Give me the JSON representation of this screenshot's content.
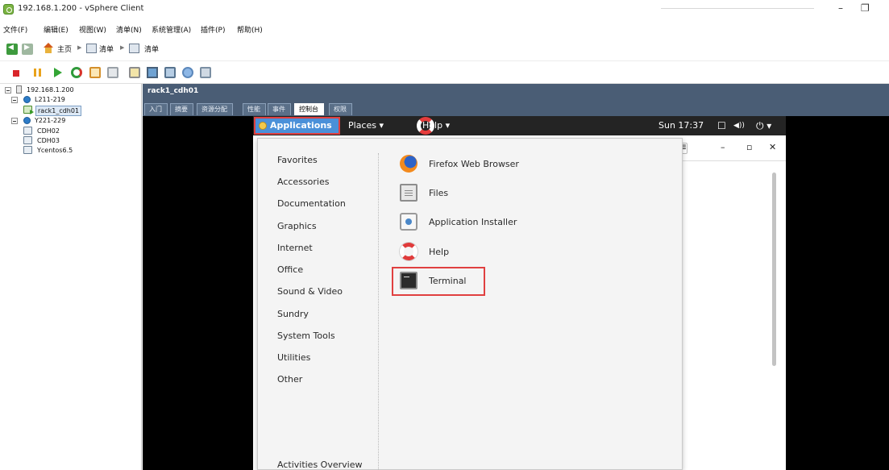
{
  "window": {
    "title": "192.168.1.200 - vSphere Client",
    "minimize": "–",
    "restore": "❐"
  },
  "menubar": [
    "文件(F)",
    "编辑(E)",
    "视图(W)",
    "清单(N)",
    "系统管理(A)",
    "插件(P)",
    "帮助(H)"
  ],
  "navbar": {
    "home": "主页",
    "inventory_1": "清单",
    "inventory_2": "清单"
  },
  "tree": {
    "root": "192.168.1.200",
    "cluster1": "L211-219",
    "vm_selected": "rack1_cdh01",
    "cluster2": "Y221-229",
    "vm2": "CDH02",
    "vm3": "CDH03",
    "vm4": "Ycentos6.5"
  },
  "pane": {
    "title": "rack1_cdh01",
    "tabs": [
      "入门",
      "摘要",
      "资源分配",
      "性能",
      "事件",
      "控制台",
      "权限"
    ],
    "active_tab": "控制台"
  },
  "gnome": {
    "applications": "Applications ▾",
    "places": "Places ▾",
    "help": "Help ▾",
    "clock": "Sun 17:37",
    "window_icon": "☐",
    "volume_icon": "◀))",
    "power_icon": "⏻ ▾"
  },
  "background_window": {
    "minimize": "–",
    "maximize": "▫",
    "close": "✕"
  },
  "categories": [
    "Favorites",
    "Accessories",
    "Documentation",
    "Graphics",
    "Internet",
    "Office",
    "Sound & Video",
    "Sundry",
    "System Tools",
    "Utilities",
    "Other"
  ],
  "activities_overview": "Activities Overview",
  "apps": [
    {
      "label": "Firefox Web Browser",
      "icon": "firefox-icon"
    },
    {
      "label": "Files",
      "icon": "files-icon"
    },
    {
      "label": "Application Installer",
      "icon": "installer-icon"
    },
    {
      "label": "Help",
      "icon": "help-icon"
    },
    {
      "label": "Terminal",
      "icon": "terminal-icon"
    }
  ],
  "colors": {
    "highlight_red": "#e04040",
    "apps_menu_blue": "#4a90d9",
    "pane_header": "#4a5d75"
  }
}
